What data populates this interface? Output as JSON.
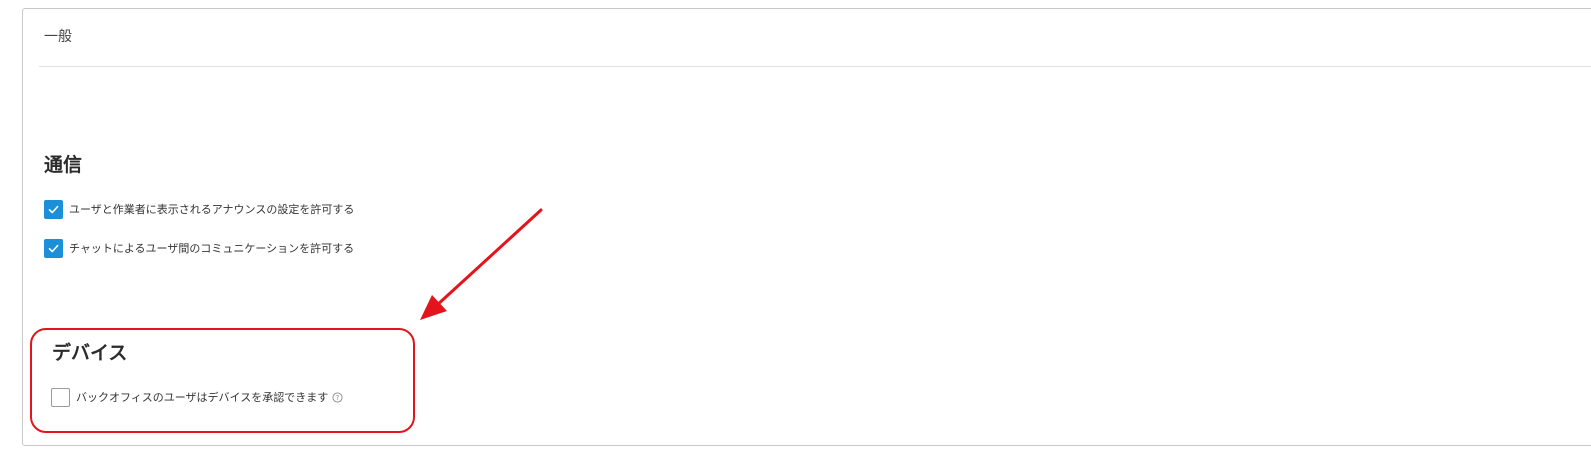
{
  "panel": {
    "title": "一般"
  },
  "communication": {
    "heading": "通信",
    "options": [
      {
        "label": "ユーザと作業者に表示されるアナウンスの設定を許可する",
        "checked": true
      },
      {
        "label": "チャットによるユーザ間のコミュニケーションを許可する",
        "checked": true
      }
    ]
  },
  "devices": {
    "heading": "デバイス",
    "options": [
      {
        "label": "バックオフィスのユーザはデバイスを承認できます",
        "checked": false,
        "help_icon": "question-circle-icon"
      }
    ]
  },
  "annotation": {
    "color": "#e3141b",
    "arrow_icon": "red-arrow-icon",
    "highlight": "devices-section"
  },
  "colors": {
    "checkbox_checked": "#1b8fd8",
    "border": "#c9c9c9"
  }
}
